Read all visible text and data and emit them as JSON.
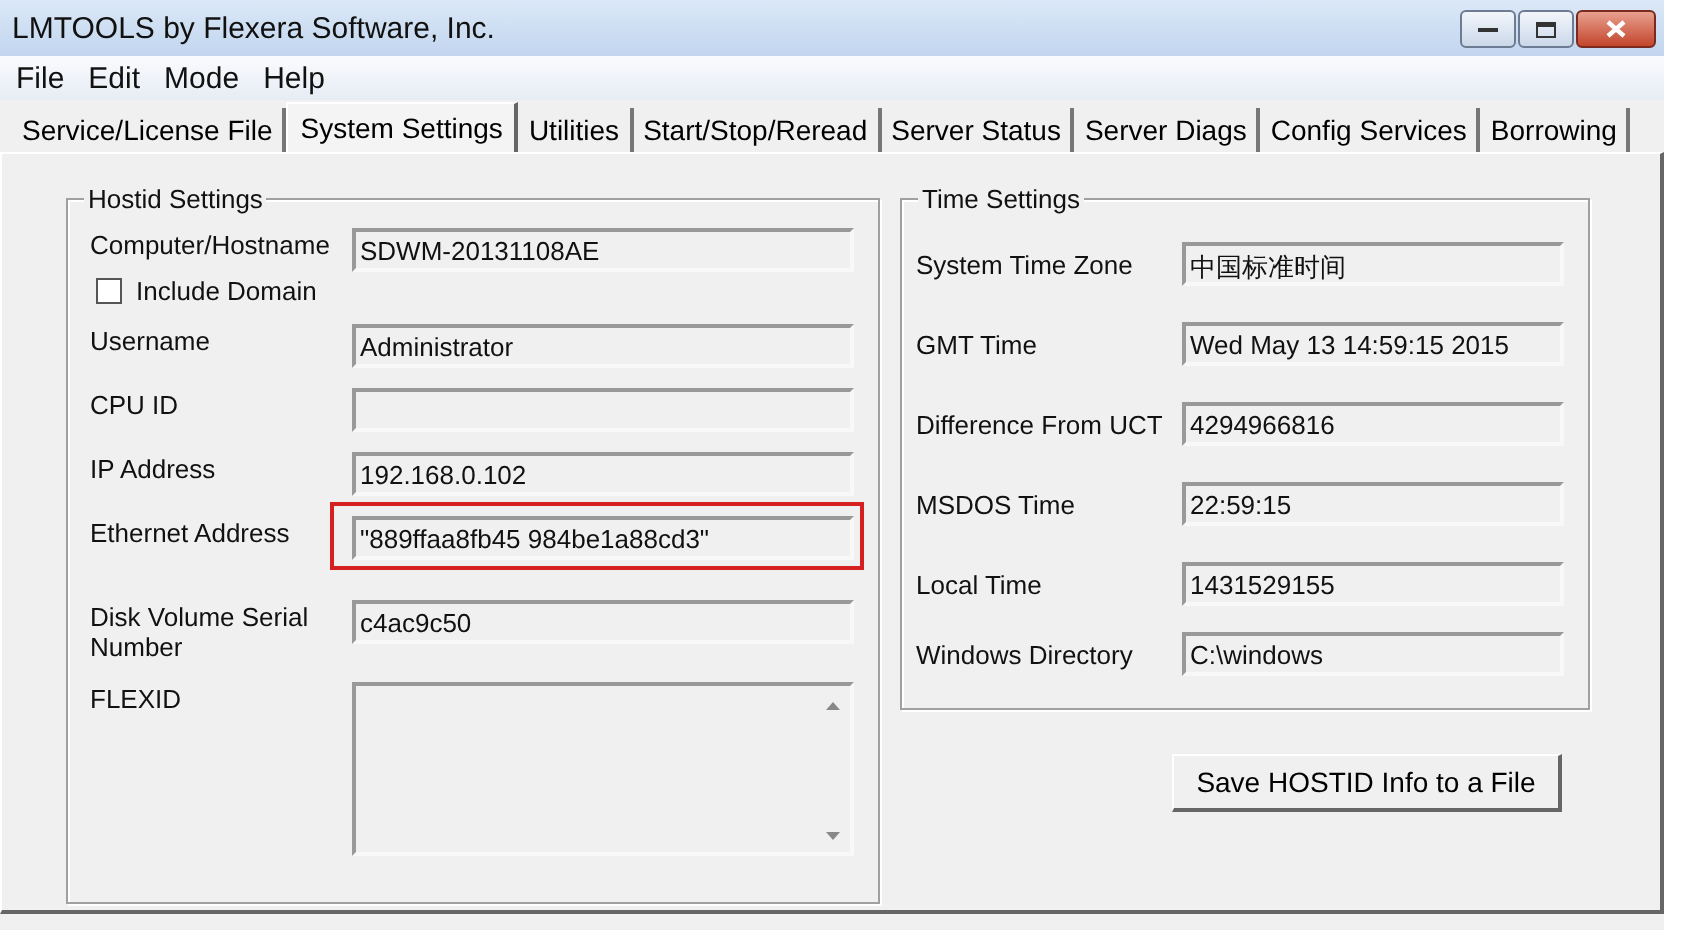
{
  "window": {
    "title": "LMTOOLS by Flexera Software, Inc."
  },
  "menu": [
    "File",
    "Edit",
    "Mode",
    "Help"
  ],
  "tabs": [
    {
      "label": "Service/License File",
      "selected": false
    },
    {
      "label": "System Settings",
      "selected": true
    },
    {
      "label": "Utilities",
      "selected": false
    },
    {
      "label": "Start/Stop/Reread",
      "selected": false
    },
    {
      "label": "Server Status",
      "selected": false
    },
    {
      "label": "Server Diags",
      "selected": false
    },
    {
      "label": "Config Services",
      "selected": false
    },
    {
      "label": "Borrowing",
      "selected": false
    }
  ],
  "hostid_settings": {
    "title": "Hostid Settings",
    "fields": [
      {
        "kind": "field",
        "label": "Computer/Hostname",
        "value": "SDWM-20131108AE",
        "highlighted": false
      },
      {
        "kind": "checkbox",
        "label": "Include Domain",
        "checked": false
      },
      {
        "kind": "field",
        "label": "Username",
        "value": "Administrator",
        "highlighted": false
      },
      {
        "kind": "field",
        "label": "CPU ID",
        "highlighted": false
      },
      {
        "kind": "field",
        "label": "IP Address",
        "value": "192.168.0.102",
        "highlighted": false
      },
      {
        "kind": "field",
        "label": "Ethernet Address",
        "value": "\"889ffaa8fb45 984be1a88cd3\"",
        "highlighted": true
      },
      {
        "kind": "field",
        "label": "Disk Volume Serial Number",
        "value": "c4ac9c50",
        "highlighted": false
      },
      {
        "kind": "textarea",
        "label": "FLEXID"
      }
    ]
  },
  "time_settings": {
    "title": "Time Settings",
    "fields": [
      {
        "label": "System Time Zone",
        "value": "中国标准时间"
      },
      {
        "label": "GMT Time",
        "value": "Wed May 13 14:59:15 2015"
      },
      {
        "label": "Difference From UCT",
        "value": "4294966816"
      },
      {
        "label": "MSDOS Time",
        "value": "22:59:15"
      },
      {
        "label": "Local Time",
        "value": "1431529155"
      },
      {
        "label": "Windows Directory",
        "value": "C:\\windows"
      }
    ]
  },
  "save_button": "Save HOSTID Info to a File"
}
